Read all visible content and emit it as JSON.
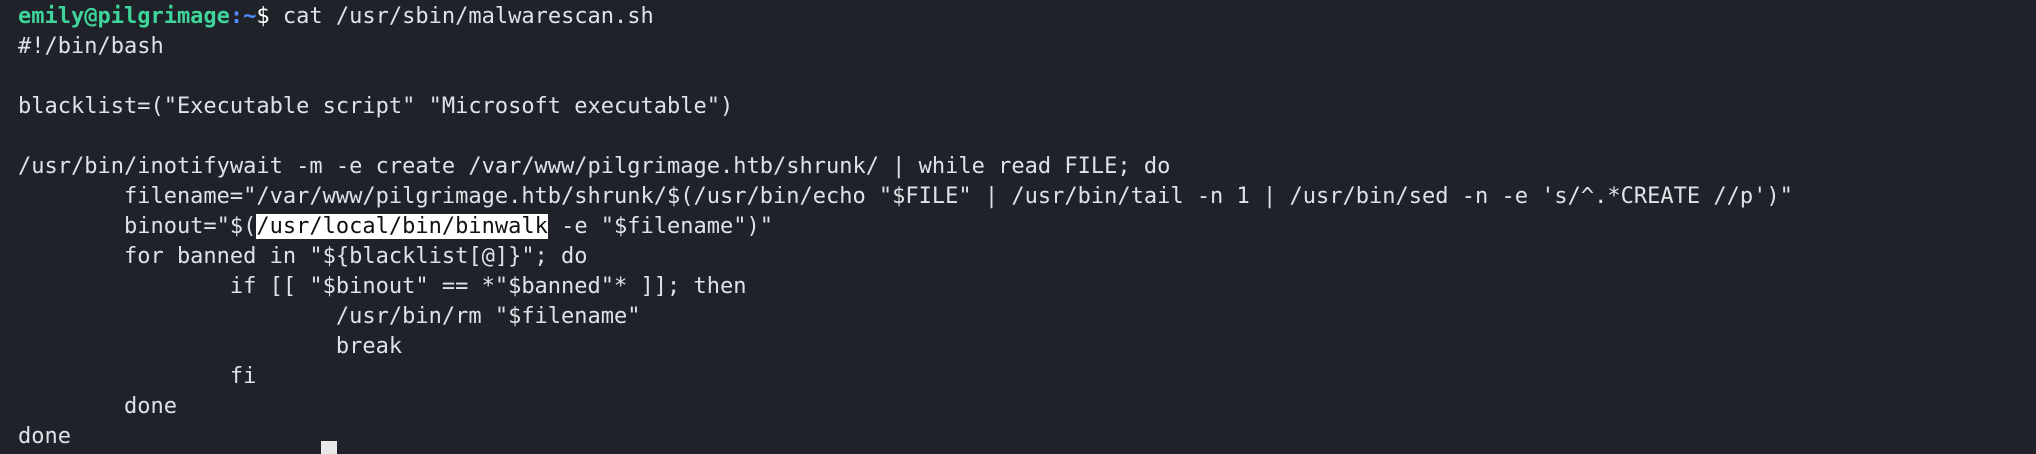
{
  "terminal": {
    "prompt": {
      "user_host": "emily@pilgrimage",
      "path": ":~",
      "symbol": "$",
      "command": "cat /usr/sbin/malwarescan.sh"
    },
    "lines": [
      "#!/bin/bash",
      "",
      "blacklist=(\"Executable script\" \"Microsoft executable\")",
      "",
      "/usr/bin/inotifywait -m -e create /var/www/pilgrimage.htb/shrunk/ | while read FILE; do",
      "        filename=\"/var/www/pilgrimage.htb/shrunk/$(/usr/bin/echo \"$FILE\" | /usr/bin/tail -n 1 | /usr/bin/sed -n -e 's/^.*CREATE //p')\"",
      "        binout=\"$(",
      "        for banned in \"${blacklist[@]}\"; do",
      "                if [[ \"$binout\" == *\"$banned\"* ]]; then",
      "                        /usr/bin/rm \"$filename\"",
      "                        break",
      "                fi",
      "        done",
      "done"
    ],
    "binout_line": {
      "prefix": "        binout=\"$(",
      "highlighted": "/usr/local/bin/binwalk",
      "suffix": " -e \"$filename\")\""
    }
  }
}
